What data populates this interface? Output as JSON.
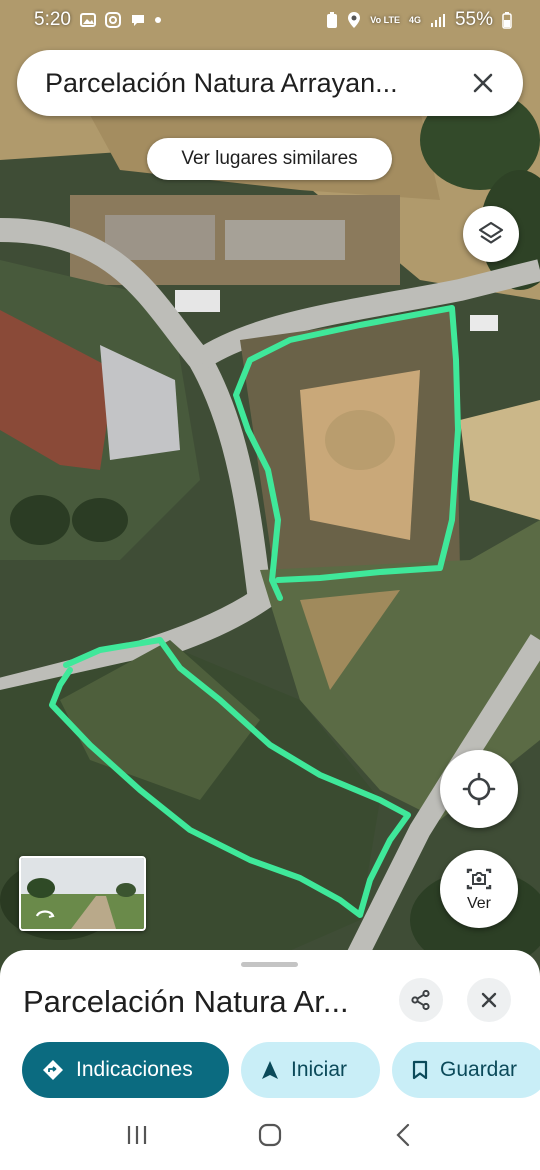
{
  "status_bar": {
    "time": "5:20",
    "network_lte": "Vo LTE",
    "network_gen": "4G",
    "battery": "55%",
    "left_icons": [
      "gallery-icon",
      "instagram-icon",
      "chat-icon",
      "dot-icon"
    ],
    "right_icons": [
      "battery-saver-icon",
      "location-icon",
      "signal-icon",
      "battery-icon"
    ]
  },
  "search": {
    "title": "Parcelación Natura Arrayan..."
  },
  "chips": {
    "similar": "Ver lugares similares"
  },
  "map_controls": {
    "view_label": "Ver"
  },
  "sheet": {
    "place_name": "Parcelación Natura Ar..."
  },
  "actions": {
    "directions": "Indicaciones",
    "start": "Iniciar",
    "save": "Guardar"
  },
  "colors": {
    "accent": "#0b6b80",
    "accent_light": "#c9eef7",
    "boundary_line": "#3fe89a"
  }
}
